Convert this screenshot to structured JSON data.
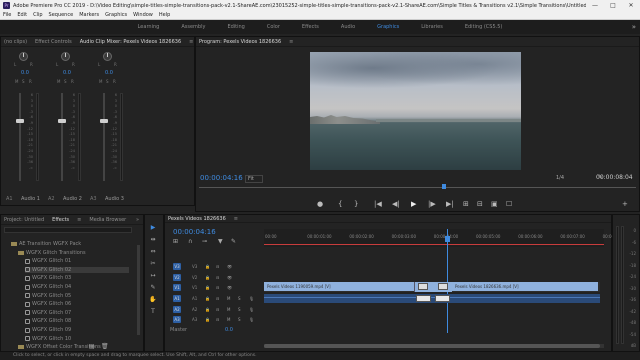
{
  "title_bar": {
    "app_icon": "Pr",
    "title": "Adobe Premiere Pro CC 2019 - D:\\Video Editing\\simple-titles-simple-transitions-pack-v2.1-ShareAE.com\\23015252-simple-titles-simple-transitions-pack-v2.1-ShareAE.com\\Simple Titles & Transitions v2.1\\Simple Transitions\\Untitled.prproj *",
    "buttons": [
      "—",
      "□",
      "✕"
    ]
  },
  "menu": [
    "File",
    "Edit",
    "Clip",
    "Sequence",
    "Markers",
    "Graphics",
    "Window",
    "Help"
  ],
  "workspaces": {
    "items": [
      "Learning",
      "Assembly",
      "Editing",
      "Color",
      "Effects",
      "Audio",
      "Graphics",
      "Libraries",
      "Editing (CS5.5)"
    ],
    "active": "Graphics",
    "more": "»"
  },
  "source_panel": {
    "tabs": [
      "(no clips)",
      "Effect Controls",
      "Audio Clip Mixer: Pexels Videos 1826636"
    ],
    "menu_icon": "≡",
    "overflow": "»",
    "channels": [
      {
        "id": "A1",
        "name": "Audio 1",
        "pan": "0.0"
      },
      {
        "id": "A2",
        "name": "Audio 2",
        "pan": "0.0"
      },
      {
        "id": "A3",
        "name": "Audio 3",
        "pan": "0.0"
      }
    ],
    "lr": [
      "L",
      "R"
    ],
    "msr": [
      "M",
      "S",
      "R"
    ],
    "db_scale": [
      "6",
      "3",
      "0",
      "-3",
      "-6",
      "-9",
      "-12",
      "-15",
      "-18",
      "-21",
      "-24",
      "-30",
      "-36",
      "-∞"
    ]
  },
  "program_panel": {
    "tab": "Program: Pexels Videos 1826636",
    "menu_icon": "≡",
    "timecode": "00:00:04:16",
    "fit": "Fit",
    "resolution": "1/4",
    "duration": "00:00:08:04",
    "playhead_fraction": 0.56,
    "controls": [
      "●",
      "{",
      "}",
      "|◀",
      "◀|",
      "▶",
      "|▶",
      "▶|",
      "⊞",
      "⊟",
      "▣",
      "☐",
      "+"
    ]
  },
  "project_panel": {
    "tabs": [
      "Project: Untitled",
      "Effects",
      "Media Browser"
    ],
    "active_tab": "Effects",
    "menu_icon": "≡",
    "overflow": "»",
    "tree": [
      {
        "label": "AE Transition WGFX Pack",
        "kind": "folder"
      },
      {
        "label": "WGFX Glitch Transitions",
        "kind": "folder"
      },
      {
        "label": "WGFX Glitch 01",
        "kind": "fx"
      },
      {
        "label": "WGFX Glitch 02",
        "kind": "fx",
        "selected": true
      },
      {
        "label": "WGFX Glitch 03",
        "kind": "fx"
      },
      {
        "label": "WGFX Glitch 04",
        "kind": "fx"
      },
      {
        "label": "WGFX Glitch 05",
        "kind": "fx"
      },
      {
        "label": "WGFX Glitch 06",
        "kind": "fx"
      },
      {
        "label": "WGFX Glitch 07",
        "kind": "fx"
      },
      {
        "label": "WGFX Glitch 08",
        "kind": "fx"
      },
      {
        "label": "WGFX Glitch 09",
        "kind": "fx"
      },
      {
        "label": "WGFX Glitch 10",
        "kind": "fx"
      },
      {
        "label": "WGFX Offset Color Transitions",
        "kind": "folder"
      }
    ]
  },
  "tools": [
    "▶",
    "⇹",
    "⇔",
    "✂",
    "↦",
    "✎",
    "✋",
    "T"
  ],
  "timeline": {
    "tab": "Pexels Videos 1826636",
    "menu_icon": "≡",
    "timecode": "00:00:04:16",
    "ruler": [
      "00:00",
      "00:00:01:00",
      "00:00:02:00",
      "00:00:03:00",
      "00:00:04:00",
      "00:00:05:00",
      "00:00:06:00",
      "00:00:07:00",
      "00:00:08:00"
    ],
    "video_tracks": [
      "V3",
      "V2",
      "V1"
    ],
    "audio_tracks": [
      "A1",
      "A2",
      "A3"
    ],
    "master": {
      "label": "Master",
      "value": "0.0"
    },
    "clips": {
      "left": "Pexels Videos 1190059.mp4 [V]",
      "right": "Pexels Videos 1826636.mp4 [V]"
    },
    "db_scale": [
      "0",
      "-6",
      "-12",
      "-18",
      "-24",
      "-30",
      "-36",
      "-42",
      "-48",
      "-54",
      "dB"
    ]
  },
  "status": "Click to select, or click in empty space and drag to marquee select. Use Shift, Alt, and Ctrl for other options.",
  "colors": {
    "accent": "#3f8be0",
    "clip": "#8fb1dd",
    "audio": "#3a5a8c"
  }
}
